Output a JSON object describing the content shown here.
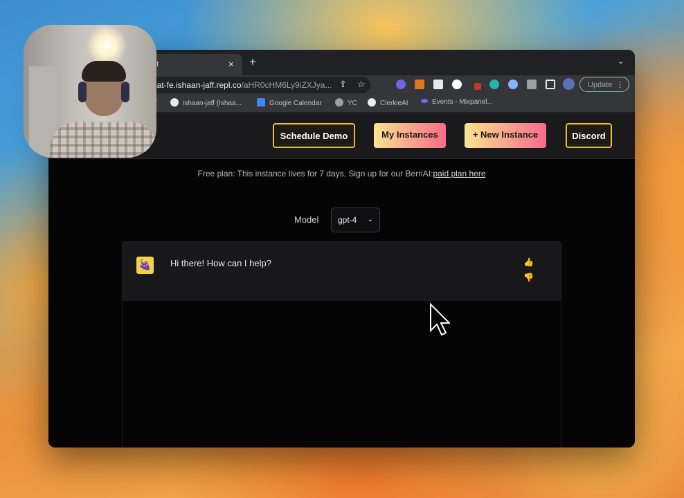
{
  "browser": {
    "tab_title": "at",
    "tab_close": "×",
    "new_tab": "+",
    "tab_menu": "⌄",
    "url_host": "hat-fe.ishaan-jaff.repl.co",
    "url_path": "/aHR0cHM6Ly9iZXJya...",
    "update_label": "Update",
    "update_dots": "⋮",
    "bookmarks": [
      {
        "label": "v"
      },
      {
        "label": "ishaan-jaff (Ishaa..."
      },
      {
        "label": "Google Calendar"
      },
      {
        "label": "YC"
      },
      {
        "label": "ClerkieAI"
      },
      {
        "label": "Events - Mixpanel..."
      }
    ]
  },
  "nav": {
    "schedule_demo": "Schedule Demo",
    "my_instances": "My Instances",
    "new_instance": "+ New Instance",
    "discord": "Discord"
  },
  "notice": {
    "text": "Free plan: This instance lives for 7 days, Sign up for our BerriAI:",
    "link": "paid plan here"
  },
  "model": {
    "label": "Model",
    "selected": "gpt-4"
  },
  "chat": {
    "messages": [
      {
        "text": "Hi there! How can I help?"
      }
    ]
  },
  "colors": {
    "accent_yellow": "#e8c12a",
    "gradient_start": "#fbe38f",
    "gradient_end": "#f56c8a",
    "update_border": "#81c995"
  }
}
